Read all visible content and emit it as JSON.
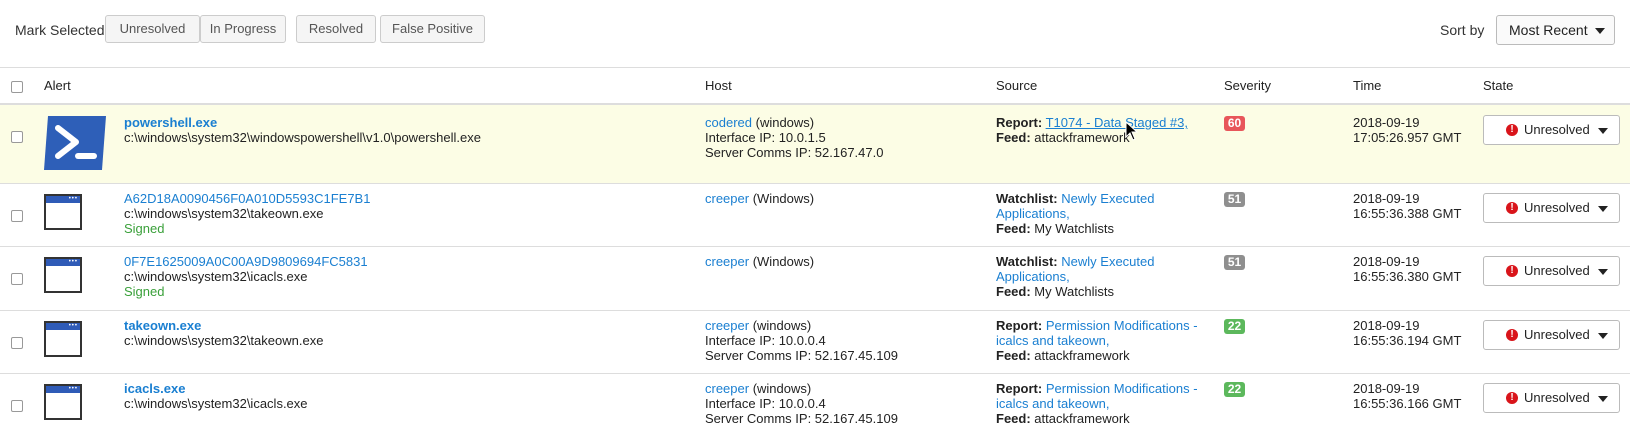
{
  "toolbar": {
    "mark_selected_label": "Mark Selected",
    "buttons": [
      "Unresolved",
      "In Progress",
      "Resolved",
      "False Positive"
    ],
    "sort_by_label": "Sort by",
    "sort_value": "Most Recent"
  },
  "table": {
    "headers": {
      "alert": "Alert",
      "host": "Host",
      "source": "Source",
      "severity": "Severity",
      "time": "Time",
      "state": "State"
    },
    "rows": [
      {
        "icon": "powershell-icon",
        "alert_name": "powershell.exe",
        "alert_path": "c:\\windows\\system32\\windowspowershell\\v1.0\\powershell.exe",
        "alert_signed": "",
        "host_name": "codered",
        "host_os": "(windows)",
        "interface_ip": "Interface IP: 10.0.1.5",
        "server_ip": "Server Comms IP: 52.167.47.0",
        "source_type": "Report:",
        "source_link_1": "T1074 - Data Staged #3,",
        "source_link_2": "",
        "feed_label": "Feed:",
        "feed_value": "attackframework",
        "severity": "60",
        "severity_color": "#e8565a",
        "date": "2018-09-19",
        "time": "17:05:26.957 GMT",
        "state": "Unresolved"
      },
      {
        "icon": "window-app-icon",
        "alert_name": "A62D18A0090456F0A010D5593C1FE7B1",
        "alert_path": "c:\\windows\\system32\\takeown.exe",
        "alert_signed": "Signed",
        "host_name": "creeper",
        "host_os": "(Windows)",
        "interface_ip": "",
        "server_ip": "",
        "source_type": "Watchlist:",
        "source_link_1": "Newly Executed",
        "source_link_2": "Applications,",
        "feed_label": "Feed:",
        "feed_value": "My Watchlists",
        "severity": "51",
        "severity_color": "#8f8f8f",
        "date": "2018-09-19",
        "time": "16:55:36.388 GMT",
        "state": "Unresolved"
      },
      {
        "icon": "window-app-icon",
        "alert_name": "0F7E1625009A0C00A9D9809694FC5831",
        "alert_path": "c:\\windows\\system32\\icacls.exe",
        "alert_signed": "Signed",
        "host_name": "creeper",
        "host_os": "(Windows)",
        "interface_ip": "",
        "server_ip": "",
        "source_type": "Watchlist:",
        "source_link_1": "Newly Executed",
        "source_link_2": "Applications,",
        "feed_label": "Feed:",
        "feed_value": "My Watchlists",
        "severity": "51",
        "severity_color": "#8f8f8f",
        "date": "2018-09-19",
        "time": "16:55:36.380 GMT",
        "state": "Unresolved"
      },
      {
        "icon": "window-app-icon",
        "alert_name": "takeown.exe",
        "alert_path": "c:\\windows\\system32\\takeown.exe",
        "alert_signed": "",
        "host_name": "creeper",
        "host_os": "(windows)",
        "interface_ip": "Interface IP: 10.0.0.4",
        "server_ip": "Server Comms IP: 52.167.45.109",
        "source_type": "Report:",
        "source_link_1": "Permission Modifications -",
        "source_link_2": "icalcs and takeown,",
        "feed_label": "Feed:",
        "feed_value": "attackframework",
        "severity": "22",
        "severity_color": "#5cb85c",
        "date": "2018-09-19",
        "time": "16:55:36.194 GMT",
        "state": "Unresolved"
      },
      {
        "icon": "window-app-icon",
        "alert_name": "icacls.exe",
        "alert_path": "c:\\windows\\system32\\icacls.exe",
        "alert_signed": "",
        "host_name": "creeper",
        "host_os": "(windows)",
        "interface_ip": "Interface IP: 10.0.0.4",
        "server_ip": "Server Comms IP: 52.167.45.109",
        "source_type": "Report:",
        "source_link_1": "Permission Modifications -",
        "source_link_2": "icalcs and takeown,",
        "feed_label": "Feed:",
        "feed_value": "attackframework",
        "severity": "22",
        "severity_color": "#5cb85c",
        "date": "2018-09-19",
        "time": "16:55:36.166 GMT",
        "state": "Unresolved"
      }
    ]
  }
}
